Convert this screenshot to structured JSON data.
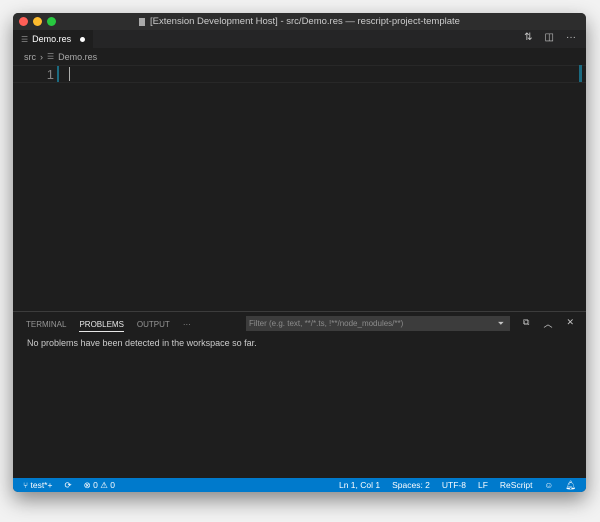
{
  "window": {
    "title": "[Extension Development Host] - src/Demo.res — rescript-project-template"
  },
  "tab": {
    "label": "Demo.res"
  },
  "breadcrumb": {
    "folder": "src",
    "file": "Demo.res"
  },
  "editor": {
    "line_numbers": [
      "1"
    ]
  },
  "panel": {
    "tabs": [
      "TERMINAL",
      "PROBLEMS",
      "OUTPUT"
    ],
    "more": "···",
    "filter_placeholder": "Filter (e.g. text, **/*.ts, !**/node_modules/**)",
    "message": "No problems have been detected in the workspace so far."
  },
  "status": {
    "branch": "test*+",
    "errors": "0",
    "warnings": "0",
    "position": "Ln 1, Col 1",
    "spaces": "Spaces: 2",
    "encoding": "UTF-8",
    "eol": "LF",
    "language": "ReScript"
  },
  "colors": {
    "accent": "#007acc",
    "close": "#ff5f57",
    "minimize": "#febc2e",
    "zoom": "#28c840"
  }
}
